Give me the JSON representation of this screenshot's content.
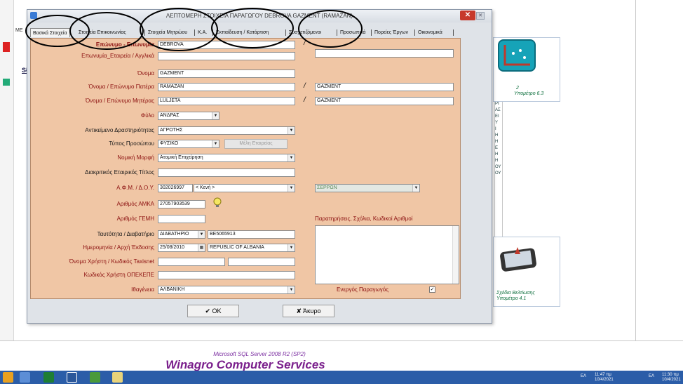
{
  "dialog": {
    "title": "ΛΕΠΤΟΜΕΡΗ ΣΤΟΙΧΕΙΑ ΠΑΡΑΓΩΓΟΥ DEBROVA GAZMENT (RAMAZAN)",
    "close_label": "✕",
    "min_label": "✕"
  },
  "tabs": [
    "Βασικά Στοιχεία",
    "Στοιχεία Επικοινωνίας",
    "Στοιχεία Μητρώου",
    "Κ.Α.",
    "Εκπαίδευση / Κατάρτιση",
    "Συσχετιζόμενοι",
    "Προσωπικά",
    "Πορείες Έργων",
    "Οικονομικά"
  ],
  "form": {
    "surname_label": "Επώνυμο - Επωνυμία",
    "surname_value": "DEBROVA",
    "company_en_label": "Επωνυμία_Εταιρεία / Αγγλικά",
    "company_en_value": "",
    "first_name_label": "Όνομα",
    "first_name_value": "GAZMENT",
    "father_label": "Όνομα / Επώνυμο Πατέρα",
    "father_first": "RAMAZAN",
    "father_last": "GAZMENT",
    "mother_label": "Όνομα / Επώνυμο Μητέρας",
    "mother_first": "LULJETA",
    "mother_last": "GAZMENT",
    "gender_label": "Φύλο",
    "gender_value": "ΑΝΔΡΑΣ",
    "activity_label": "Αντικείμενο Δραστηριότητας",
    "activity_value": "ΑΓΡΟΤΗΣ",
    "person_type_label": "Τύπος Προσώπου",
    "person_type_value": "ΦΥΣΙΚΟ",
    "company_members_button": "Μέλη Εταιρείας",
    "legal_form_label": "Νομική Μορφή",
    "legal_form_value": "Ατομική Επιχείρηση",
    "trade_title_label": "Διακριτικός Εταιρικός Τίτλος",
    "trade_title_value": "",
    "afm_label": "Α.Φ.Μ. / Δ.Ο.Υ.",
    "afm_value": "302026997",
    "doy_value": "< Κενή >",
    "region_value": "ΣΕΡΡΩΝ",
    "amka_label": "Αριθμός ΑΜΚΑ",
    "amka_value": "27057903539",
    "gemi_label": "Αριθμός ΓΕΜΗ",
    "gemi_value": "",
    "id_label": "Ταυτότητα / Διαβατήριο",
    "id_type_value": "ΔΙΑΒΑΤΗΡΙΟ",
    "id_number_value": "BE5065913",
    "issue_label": "Ημερομηνία / Αρχή Έκδοσης",
    "issue_date_value": "25/08/2010",
    "issue_authority_value": "REPUBLIC OF ALBANIA",
    "taxisnet_label": "Όνομα Χρήστη / Κωδικός Taxisnet",
    "taxisnet_user": "",
    "taxisnet_pass": "",
    "opekepe_label": "Κωδικός Χρήστη ΟΠΕΚΕΠΕ",
    "opekepe_value": "",
    "nationality_label": "Ιθαγένεια",
    "nationality_value": "ΑΛΒΑΝΙΚΗ",
    "notes_label": "Παρατηρήσεις, Σχόλια, Κωδικοί Αριθμοί",
    "notes_value": "",
    "active_label": "Ενεργός Παραγωγός",
    "active_checked": "✓",
    "sep_char": "/"
  },
  "buttons": {
    "ok": "✔ OK",
    "cancel": "✘ Άκυρο"
  },
  "background": {
    "tile1_title": "Υπομέτρο 6.3",
    "tile1_num": "2",
    "tile2_title": "Σχέδια Βελτίωσης\nΥπομέτρο 4.1",
    "tile2_line1": "Σχέδια Βελτίωσης",
    "tile2_line2": "Υπομέτρο 4.1",
    "side_list": [
      "ΙΕ",
      "ΙΑ",
      "ΑΣ",
      "Ρ",
      "Ο/",
      "ΑΖ",
      "ΑΝ",
      "ΙΜ",
      "ΙΚ",
      "Π",
      "ΡΙ",
      "ΑΣ",
      "ΕΙ",
      "Υ",
      "Ι",
      "Η",
      "Η",
      "Ε",
      "Η",
      "Η",
      "ΟΥ",
      "ΟΥ"
    ],
    "footer_sql": "Microsoft SQL Server 2008 R2 (SP2)",
    "footer_brand": "Winagro Computer Services",
    "left_frag1": "ΜΕ",
    "left_frag2": "Sł"
  },
  "taskbar": {
    "time1": "11:47 πμ",
    "date1": "10/4/2021",
    "time2": "11:30 πμ",
    "date2": "10/4/2021",
    "lang1": "ΕΛ",
    "lang2": "ΕΛ"
  },
  "colors": {
    "form_bg": "#f0c6a5",
    "label_red": "#8b0f0f",
    "brand_purple": "#7a1f8c",
    "taskbar_blue": "#2b5da8",
    "close_red": "#c7392b"
  }
}
